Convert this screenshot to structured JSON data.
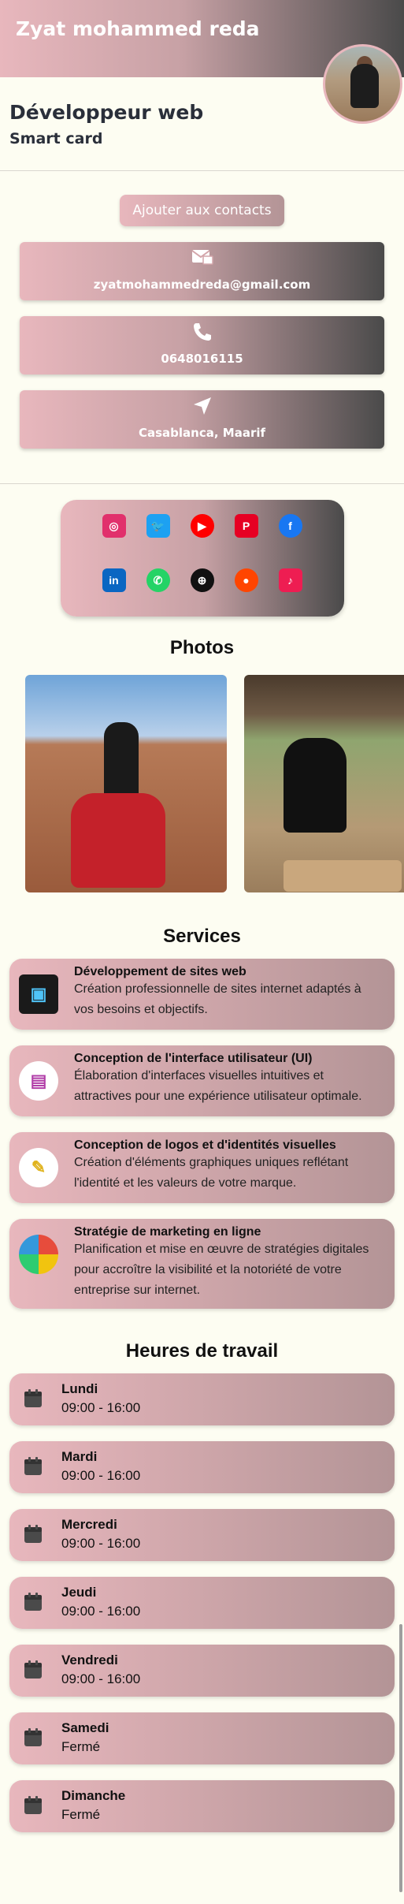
{
  "header": {
    "name": "Zyat mohammed reda",
    "job_title": "Développeur web",
    "subtitle": "Smart card"
  },
  "contacts": {
    "add_button": "Ajouter aux contacts",
    "email": "zyatmohammedreda@gmail.com",
    "phone": "0648016115",
    "location": "Casablanca, Maarif"
  },
  "socials": [
    {
      "name": "instagram-icon",
      "glyph": "◎",
      "color": "#e1306c"
    },
    {
      "name": "twitter-icon",
      "glyph": "🐦",
      "color": "#1da1f2"
    },
    {
      "name": "youtube-icon",
      "glyph": "▶",
      "color": "#ff0000"
    },
    {
      "name": "pinterest-icon",
      "glyph": "P",
      "color": "#e60023"
    },
    {
      "name": "facebook-icon",
      "glyph": "f",
      "color": "#1877f2"
    },
    {
      "name": "linkedin-icon",
      "glyph": "in",
      "color": "#0a66c2"
    },
    {
      "name": "whatsapp-icon",
      "glyph": "✆",
      "color": "#25d366"
    },
    {
      "name": "website-icon",
      "glyph": "⊕",
      "color": "#111111"
    },
    {
      "name": "reddit-icon",
      "glyph": "●",
      "color": "#ff4500"
    },
    {
      "name": "tiktok-icon",
      "glyph": "♪",
      "color": "#ee1d52"
    }
  ],
  "sections": {
    "photos": "Photos",
    "services": "Services",
    "hours": "Heures de travail"
  },
  "services": [
    {
      "title": "Développement de sites web",
      "desc": "Création professionnelle de sites internet adaptés à vos besoins et objectifs."
    },
    {
      "title": "Conception de l'interface utilisateur (UI)",
      "desc": "Élaboration d'interfaces visuelles intuitives et attractives pour une expérience utilisateur optimale."
    },
    {
      "title": "Conception de logos et d'identités visuelles",
      "desc": "Création d'éléments graphiques uniques reflétant l'identité et les valeurs de votre marque."
    },
    {
      "title": "Stratégie de marketing en ligne",
      "desc": "Planification et mise en œuvre de stratégies digitales pour accroître la visibilité et la notoriété de votre entreprise sur internet."
    }
  ],
  "hours": [
    {
      "day": "Lundi",
      "time": "09:00 - 16:00"
    },
    {
      "day": "Mardi",
      "time": "09:00 - 16:00"
    },
    {
      "day": "Mercredi",
      "time": "09:00 - 16:00"
    },
    {
      "day": "Jeudi",
      "time": "09:00 - 16:00"
    },
    {
      "day": "Vendredi",
      "time": "09:00 - 16:00"
    },
    {
      "day": "Samedi",
      "time": "Fermé"
    },
    {
      "day": "Dimanche",
      "time": "Fermé"
    }
  ],
  "colors": {
    "accent_pink": "#e8b7bd",
    "accent_dark": "#4a4a4a",
    "background": "#fdfdf2"
  }
}
